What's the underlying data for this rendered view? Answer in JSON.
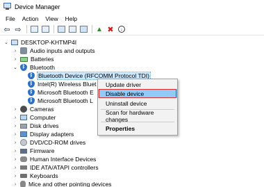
{
  "window": {
    "title": "Device Manager"
  },
  "menu": [
    "File",
    "Action",
    "View",
    "Help"
  ],
  "toolbar": {
    "icons": [
      "back-icon",
      "forward-icon",
      "properties-icon",
      "show-hidden-icon",
      "help-icon",
      "view-icon",
      "monitor-icon",
      "update-driver-icon",
      "uninstall-icon",
      "download-icon"
    ]
  },
  "tree": {
    "root": "DESKTOP-KHTMP4I",
    "categories": {
      "audio": "Audio inputs and outputs",
      "batteries": "Batteries",
      "bluetooth": "Bluetooth",
      "cameras": "Cameras",
      "computer": "Computer",
      "disk": "Disk drives",
      "display": "Display adapters",
      "dvd": "DVD/CD-ROM drives",
      "firmware": "Firmware",
      "hid": "Human Interface Devices",
      "ide": "IDE ATA/ATAPI controllers",
      "keyboards": "Keyboards",
      "mice": "Mice and other pointing devices"
    },
    "bluetooth_children": [
      "Bluetooth Device (RFCOMM Protocol TDI)",
      "Intel(R) Wireless Bluet",
      "Microsoft Bluetooth E",
      "Microsoft Bluetooth L"
    ]
  },
  "context_menu": {
    "update": "Update driver",
    "disable": "Disable device",
    "uninstall": "Uninstall device",
    "scan": "Scan for hardware changes",
    "properties": "Properties"
  }
}
